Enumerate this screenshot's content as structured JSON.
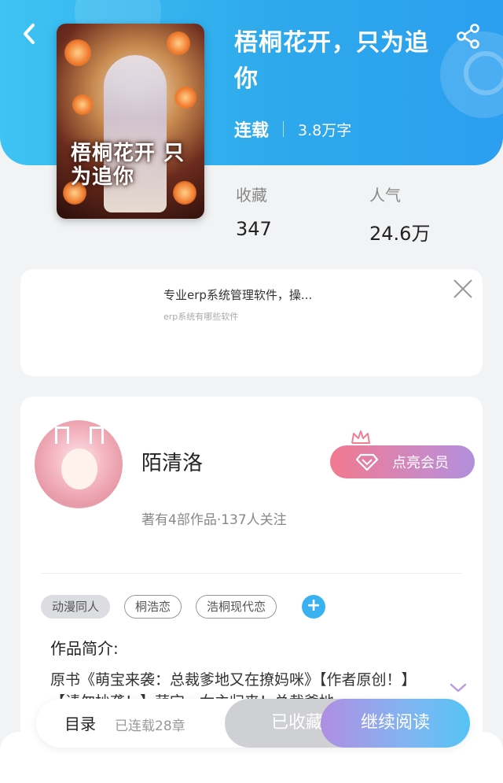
{
  "book": {
    "title": "梧桐花开，只为追你",
    "cover_title": "梧桐花开 只为追你",
    "status": "连载",
    "word_count": "3.8万字",
    "stats": [
      {
        "label": "收藏",
        "value": "347"
      },
      {
        "label": "人气",
        "value": "24.6万"
      }
    ]
  },
  "ad": {
    "title": "专业erp系统管理软件，操...",
    "subtitle": "erp系统有哪些软件"
  },
  "author": {
    "name": "陌清洛",
    "stats": "著有4部作品·137人关注",
    "vip_button": "点亮会员"
  },
  "tags": [
    "动漫同人",
    "桐浩恋",
    "浩桐现代恋"
  ],
  "intro": {
    "label": "作品简介:",
    "text": "原书《萌宝来袭：总裁爹地又在撩妈咪》【作者原创！】【请勿抄袭！】萌宝、女主归来！总裁爹地"
  },
  "bottom_bar": {
    "toc_label": "目录",
    "toc_count": "已连载28章",
    "favorite_label": "已收藏",
    "read_label": "继续阅读"
  },
  "colors": {
    "header": "#2ea9ec",
    "accent_blue": "#3ab2f2",
    "vip_pink": "#f2798f"
  },
  "icons": {
    "back": "back-arrow-icon",
    "share": "share-icon",
    "close": "close-icon",
    "gem": "diamond-icon",
    "crown": "crown-icon",
    "add": "plus-icon",
    "expand": "chevron-down-icon"
  }
}
